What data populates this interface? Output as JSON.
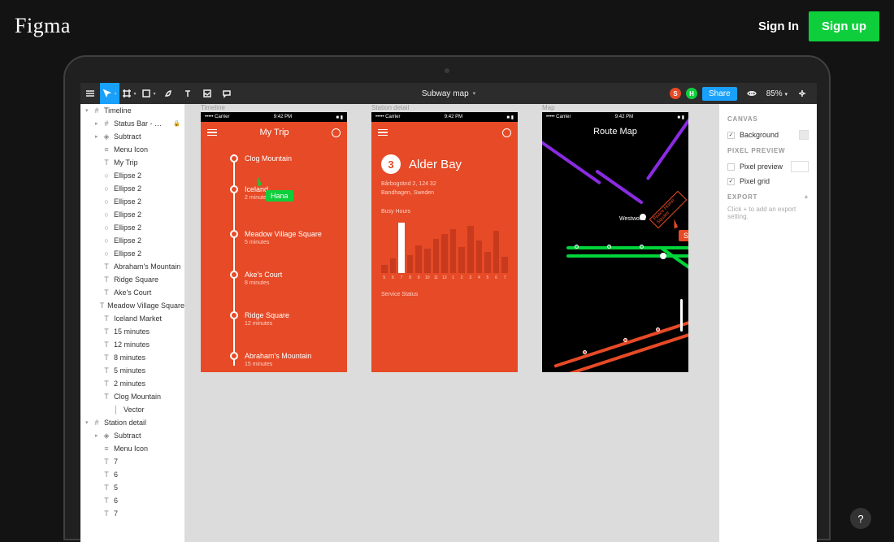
{
  "header": {
    "logo": "Figma",
    "signin": "Sign In",
    "signup": "Sign up"
  },
  "toolbar": {
    "doc_title": "Subway map",
    "avatars": [
      {
        "letter": "S",
        "color": "#E74A26"
      },
      {
        "letter": "H",
        "color": "#0FCE3C"
      }
    ],
    "share": "Share",
    "zoom": "85%"
  },
  "layers": [
    {
      "indent": 0,
      "toggle": "▾",
      "icon": "frame",
      "name": "Timeline"
    },
    {
      "indent": 1,
      "toggle": "▸",
      "icon": "frame",
      "name": "Status Bar - …",
      "locked": true
    },
    {
      "indent": 1,
      "toggle": "▸",
      "icon": "component",
      "name": "Subtract"
    },
    {
      "indent": 1,
      "toggle": "",
      "icon": "group",
      "name": "Menu Icon"
    },
    {
      "indent": 1,
      "toggle": "",
      "icon": "text",
      "name": "My Trip"
    },
    {
      "indent": 1,
      "toggle": "",
      "icon": "ellipse",
      "name": "Ellipse 2"
    },
    {
      "indent": 1,
      "toggle": "",
      "icon": "ellipse",
      "name": "Ellipse 2"
    },
    {
      "indent": 1,
      "toggle": "",
      "icon": "ellipse",
      "name": "Ellipse 2"
    },
    {
      "indent": 1,
      "toggle": "",
      "icon": "ellipse",
      "name": "Ellipse 2"
    },
    {
      "indent": 1,
      "toggle": "",
      "icon": "ellipse",
      "name": "Ellipse 2"
    },
    {
      "indent": 1,
      "toggle": "",
      "icon": "ellipse",
      "name": "Ellipse 2"
    },
    {
      "indent": 1,
      "toggle": "",
      "icon": "ellipse",
      "name": "Ellipse 2"
    },
    {
      "indent": 1,
      "toggle": "",
      "icon": "text",
      "name": "Abraham's Mountain"
    },
    {
      "indent": 1,
      "toggle": "",
      "icon": "text",
      "name": "Ridge Square"
    },
    {
      "indent": 1,
      "toggle": "",
      "icon": "text",
      "name": "Ake's Court"
    },
    {
      "indent": 1,
      "toggle": "",
      "icon": "text",
      "name": "Meadow Village Square"
    },
    {
      "indent": 1,
      "toggle": "",
      "icon": "text",
      "name": "Iceland Market"
    },
    {
      "indent": 1,
      "toggle": "",
      "icon": "text",
      "name": "15 minutes"
    },
    {
      "indent": 1,
      "toggle": "",
      "icon": "text",
      "name": "12 minutes"
    },
    {
      "indent": 1,
      "toggle": "",
      "icon": "text",
      "name": "8 minutes"
    },
    {
      "indent": 1,
      "toggle": "",
      "icon": "text",
      "name": "5 minutes"
    },
    {
      "indent": 1,
      "toggle": "",
      "icon": "text",
      "name": "2 minutes"
    },
    {
      "indent": 1,
      "toggle": "",
      "icon": "text",
      "name": "Clog Mountain"
    },
    {
      "indent": 2,
      "toggle": "",
      "icon": "vector",
      "name": "Vector"
    },
    {
      "indent": 0,
      "toggle": "▾",
      "icon": "frame",
      "name": "Station detail"
    },
    {
      "indent": 1,
      "toggle": "▸",
      "icon": "component",
      "name": "Subtract"
    },
    {
      "indent": 1,
      "toggle": "",
      "icon": "group",
      "name": "Menu Icon"
    },
    {
      "indent": 1,
      "toggle": "",
      "icon": "text",
      "name": "7"
    },
    {
      "indent": 1,
      "toggle": "",
      "icon": "text",
      "name": "6"
    },
    {
      "indent": 1,
      "toggle": "",
      "icon": "text",
      "name": "5"
    },
    {
      "indent": 1,
      "toggle": "",
      "icon": "text",
      "name": "6"
    },
    {
      "indent": 1,
      "toggle": "",
      "icon": "text",
      "name": "7"
    }
  ],
  "props": {
    "canvas": "CANVAS",
    "background": "Background",
    "pixel_preview": "PIXEL PREVIEW",
    "pixel_preview_opt": "Pixel preview",
    "pixel_grid_opt": "Pixel grid",
    "export": "EXPORT",
    "export_hint": "Click + to add an export setting."
  },
  "frames": {
    "timeline": {
      "label": "Timeline",
      "status_time": "9:42 PM",
      "status_left": "••••• Carrier  ",
      "title": "My Trip",
      "stops": [
        {
          "name": "Clog Mountain",
          "sub": ""
        },
        {
          "name": "Iceland",
          "sub": "2 minutes"
        },
        {
          "name": "Meadow Village Square",
          "sub": "5 minutes"
        },
        {
          "name": "Ake's Court",
          "sub": "8 minutes"
        },
        {
          "name": "Ridge Square",
          "sub": "12 minutes"
        },
        {
          "name": "Abraham's Mountain",
          "sub": "15 minutes"
        }
      ]
    },
    "detail": {
      "label": "Station detail",
      "status_time": "9:42 PM",
      "line_num": "3",
      "title": "Alder Bay",
      "addr1": "Bårbogränd 2, 124 32",
      "addr2": "Bandhagen, Sweden",
      "busy": "Busy Hours",
      "service": "Service Status",
      "hours": [
        "5",
        "6",
        "7",
        "8",
        "9",
        "10",
        "11",
        "12",
        "1",
        "2",
        "3",
        "4",
        "5",
        "6",
        "7"
      ]
    },
    "map": {
      "label": "Map",
      "title": "Route Map",
      "station": "Westwood",
      "rot_label": "Peace Home Square"
    }
  },
  "cursors": {
    "hana": {
      "name": "Hana",
      "color": "#0FCE3C"
    },
    "sean": {
      "name": "Sean",
      "color": "#E74A26"
    }
  },
  "chart_data": {
    "type": "bar",
    "title": "Busy Hours",
    "categories": [
      "5",
      "6",
      "7",
      "8",
      "9",
      "10",
      "11",
      "12",
      "1",
      "2",
      "3",
      "4",
      "5",
      "6",
      "7"
    ],
    "values": [
      10,
      18,
      62,
      22,
      34,
      30,
      42,
      48,
      54,
      32,
      58,
      40,
      26,
      52,
      20
    ],
    "highlight_index": 2,
    "xlabel": "",
    "ylabel": "",
    "ylim": [
      0,
      66
    ]
  },
  "help": "?"
}
